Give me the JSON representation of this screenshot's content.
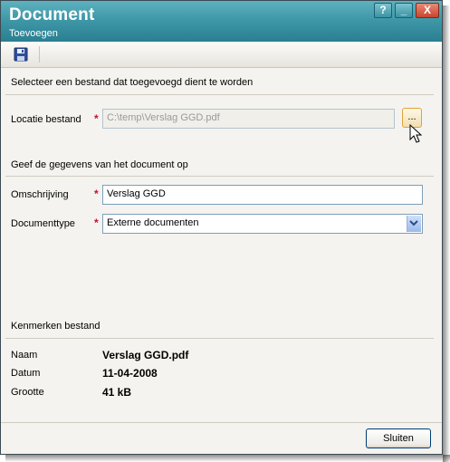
{
  "window": {
    "title": "Document",
    "subtitle": "Toevoegen",
    "help_glyph": "?",
    "min_glyph": "_",
    "close_glyph": "X"
  },
  "toolbar": {
    "save_icon": "floppy-disk-icon"
  },
  "sections": {
    "select_file": "Selecteer een bestand dat toegevoegd dient te worden",
    "document_details": "Geef de gegevens van het document op",
    "file_properties": "Kenmerken bestand"
  },
  "form": {
    "required_mark": "*",
    "location": {
      "label": "Locatie bestand",
      "value": "C:\\temp\\Verslag GGD.pdf",
      "browse_label": "..."
    },
    "description": {
      "label": "Omschrijving",
      "value": "Verslag GGD"
    },
    "doctype": {
      "label": "Documenttype",
      "value": "Externe documenten"
    }
  },
  "properties": {
    "name": {
      "label": "Naam",
      "value": "Verslag GGD.pdf"
    },
    "date": {
      "label": "Datum",
      "value": "11-04-2008"
    },
    "size": {
      "label": "Grootte",
      "value": "41 kB"
    }
  },
  "footer": {
    "close_label": "Sluiten"
  },
  "colors": {
    "title_bar": "#3f98a8",
    "required": "#c8102e",
    "browse_highlight": "#e3a13a"
  }
}
